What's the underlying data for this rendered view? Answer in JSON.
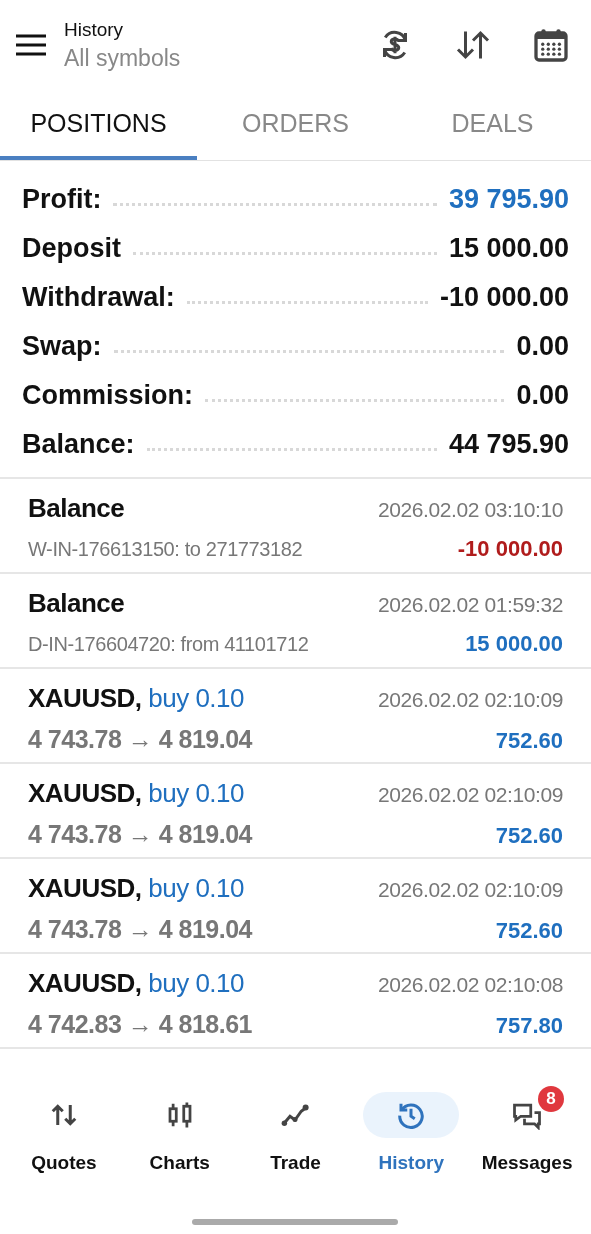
{
  "header": {
    "title": "History",
    "subtitle": "All symbols"
  },
  "tabs": [
    {
      "label": "POSITIONS",
      "selected": true
    },
    {
      "label": "ORDERS",
      "selected": false
    },
    {
      "label": "DEALS",
      "selected": false
    }
  ],
  "summary": [
    {
      "label": "Profit:",
      "value": "39 795.90",
      "color": "#1f6fbf"
    },
    {
      "label": "Deposit",
      "value": "15 000.00",
      "color": "#111111"
    },
    {
      "label": "Withdrawal:",
      "value": "-10 000.00",
      "color": "#111111"
    },
    {
      "label": "Swap:",
      "value": "0.00",
      "color": "#111111"
    },
    {
      "label": "Commission:",
      "value": "0.00",
      "color": "#111111"
    },
    {
      "label": "Balance:",
      "value": "44 795.90",
      "color": "#111111"
    }
  ],
  "deals": [
    {
      "kind": "balance",
      "title": "Balance",
      "time": "2026.02.02 03:10:10",
      "comment": "W-IN-176613150: to 271773182",
      "amount": "-10 000.00",
      "color": "#b01c1c"
    },
    {
      "kind": "balance",
      "title": "Balance",
      "time": "2026.02.02 01:59:32",
      "comment": "D-IN-176604720: from 41101712",
      "amount": "15 000.00",
      "color": "#1f6fbf"
    },
    {
      "kind": "trade",
      "symbol": "XAUUSD,",
      "side": "buy 0.10",
      "time": "2026.02.02 02:10:09",
      "prices": "4 743.78 → 4 819.04",
      "amount": "752.60",
      "color": "#1f6fbf"
    },
    {
      "kind": "trade",
      "symbol": "XAUUSD,",
      "side": "buy 0.10",
      "time": "2026.02.02 02:10:09",
      "prices": "4 743.78 → 4 819.04",
      "amount": "752.60",
      "color": "#1f6fbf"
    },
    {
      "kind": "trade",
      "symbol": "XAUUSD,",
      "side": "buy 0.10",
      "time": "2026.02.02 02:10:09",
      "prices": "4 743.78 → 4 819.04",
      "amount": "752.60",
      "color": "#1f6fbf"
    },
    {
      "kind": "trade",
      "symbol": "XAUUSD,",
      "side": "buy 0.10",
      "time": "2026.02.02 02:10:08",
      "prices": "4 742.83 → 4 818.61",
      "amount": "757.80",
      "color": "#1f6fbf"
    }
  ],
  "nav": [
    {
      "label": "Quotes",
      "selected": false
    },
    {
      "label": "Charts",
      "selected": false
    },
    {
      "label": "Trade",
      "selected": false
    },
    {
      "label": "History",
      "selected": true
    },
    {
      "label": "Messages",
      "selected": false,
      "badge": "8"
    }
  ]
}
